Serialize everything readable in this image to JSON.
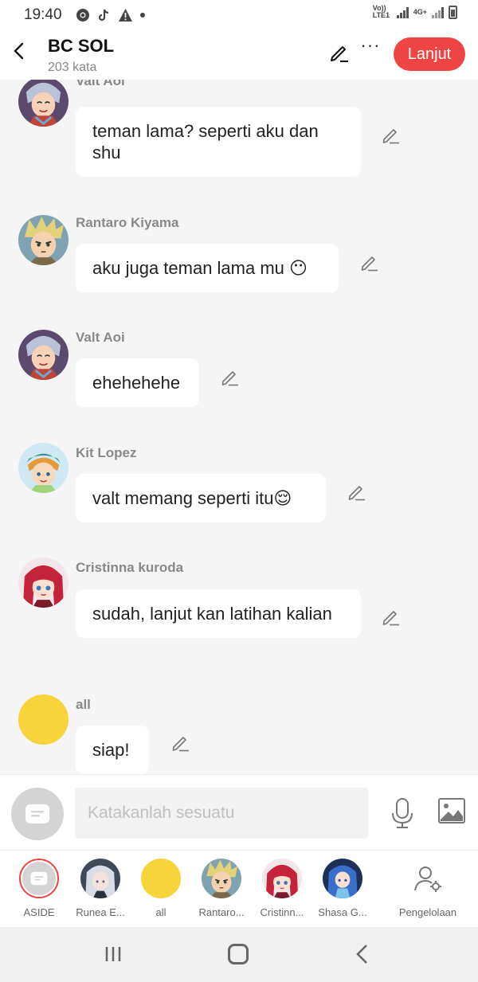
{
  "status": {
    "time": "19:40",
    "net1": "Vo)) LTE1",
    "net2": "4G+"
  },
  "header": {
    "title": "BC SOL",
    "subtitle": "203 kata",
    "next_label": "Lanjut"
  },
  "messages": [
    {
      "name": "Valt Aoi",
      "text": "teman lama? seperti aku dan shu",
      "avatar": "valt"
    },
    {
      "name": "Rantaro Kiyama",
      "text": "aku juga teman lama mu 😶",
      "avatar": "rantaro"
    },
    {
      "name": "Valt Aoi",
      "text": "ehehehehe",
      "avatar": "valt"
    },
    {
      "name": "Kit Lopez",
      "text": "valt memang seperti itu😌",
      "avatar": "kit"
    },
    {
      "name": "Cristinna kuroda",
      "text": "sudah, lanjut kan latihan kalian",
      "avatar": "cristinna"
    },
    {
      "name": "all",
      "text": "siap!",
      "avatar": "all"
    }
  ],
  "input": {
    "placeholder": "Katakanlah sesuatu"
  },
  "characters": [
    {
      "label": "ASIDE",
      "avatar": "aside"
    },
    {
      "label": "Runea E...",
      "avatar": "runea"
    },
    {
      "label": "all",
      "avatar": "all"
    },
    {
      "label": "Rantaro...",
      "avatar": "rantaro"
    },
    {
      "label": "Cristinn...",
      "avatar": "cristinna"
    },
    {
      "label": "Shasa G...",
      "avatar": "shasa"
    },
    {
      "label": "Pengelolaan",
      "avatar": "manage-icon"
    }
  ],
  "colors": {
    "accent": "#ef4444",
    "all_avatar": "#f7d43a"
  }
}
